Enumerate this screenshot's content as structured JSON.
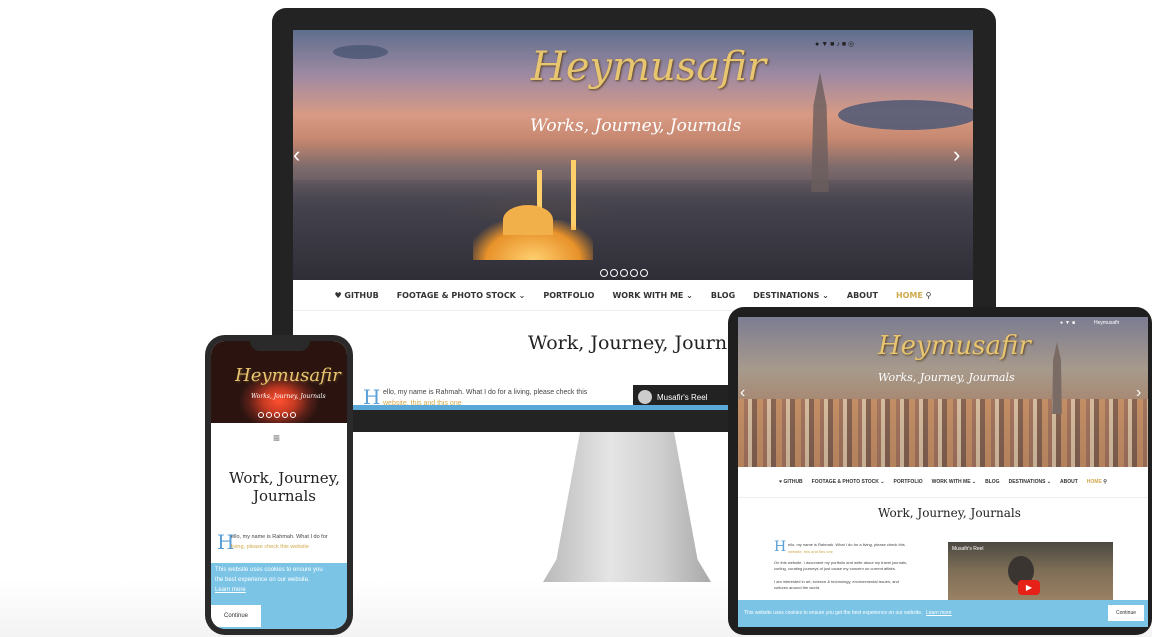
{
  "brand": {
    "logo_text": "Heymusafir",
    "tagline": "Works, Journey, Journals"
  },
  "desktop": {
    "nav": [
      {
        "label": "♥ GITHUB"
      },
      {
        "label": "FOOTAGE & PHOTO STOCK ⌄"
      },
      {
        "label": "PORTFOLIO"
      },
      {
        "label": "WORK WITH ME ⌄"
      },
      {
        "label": "BLOG"
      },
      {
        "label": "DESTINATIONS ⌄"
      },
      {
        "label": "ABOUT"
      },
      {
        "label": "HOME"
      }
    ],
    "page_title": "Work, Journey, Journals",
    "intro_drop": "H",
    "intro_line1": "ello, my name is Rahmah. What I do for a living, please check this",
    "intro_line2": "website, this and this one",
    "video_title": "Musafir's Reel",
    "social_icons": [
      "github-icon",
      "twitter-icon",
      "instagram-icon",
      "tiktok-icon",
      "youtube-icon",
      "camera-icon"
    ]
  },
  "phone": {
    "page_title_line1": "Work, Journey,",
    "page_title_line2": "Journals",
    "menu_icon": "hamburger-icon",
    "intro_drop": "H",
    "intro_line1": "ello, my name is Rahmah. What I do for",
    "intro_line2": "living, please check this website",
    "cookie_text_line1": "This website uses cookies to ensure you",
    "cookie_text_line2": "the best experience on our website.",
    "cookie_learn_more": "Learn more",
    "cookie_continue": "Continue"
  },
  "tablet": {
    "nav": [
      {
        "label": "♥ GITHUB"
      },
      {
        "label": "FOOTAGE & PHOTO STOCK ⌄"
      },
      {
        "label": "PORTFOLIO"
      },
      {
        "label": "WORK WITH ME ⌄"
      },
      {
        "label": "BLOG"
      },
      {
        "label": "DESTINATIONS ⌄"
      },
      {
        "label": "ABOUT"
      },
      {
        "label": "HOME"
      }
    ],
    "page_title": "Work, Journey, Journals",
    "intro_drop": "H",
    "intro_line1": "ello, my name is Rahmah. What I do for a living, please check this",
    "intro_line2": "website, this and this one",
    "intro_line3": "On this website, I document my portfolio and write about my travel journals,",
    "intro_line4": "curling, curating journeys of just cause my concern on current affairs.",
    "intro_line5": "I am interested in art, science & technology, environmental issues, and",
    "intro_line6": "cultures around the world.",
    "video_title": "Musafir's Reel",
    "top_label": "Heymusafir",
    "cookie_text": "This website uses cookies to ensure you get the best experience on our website.",
    "cookie_learn_more": "Learn more",
    "cookie_continue": "Continue"
  }
}
